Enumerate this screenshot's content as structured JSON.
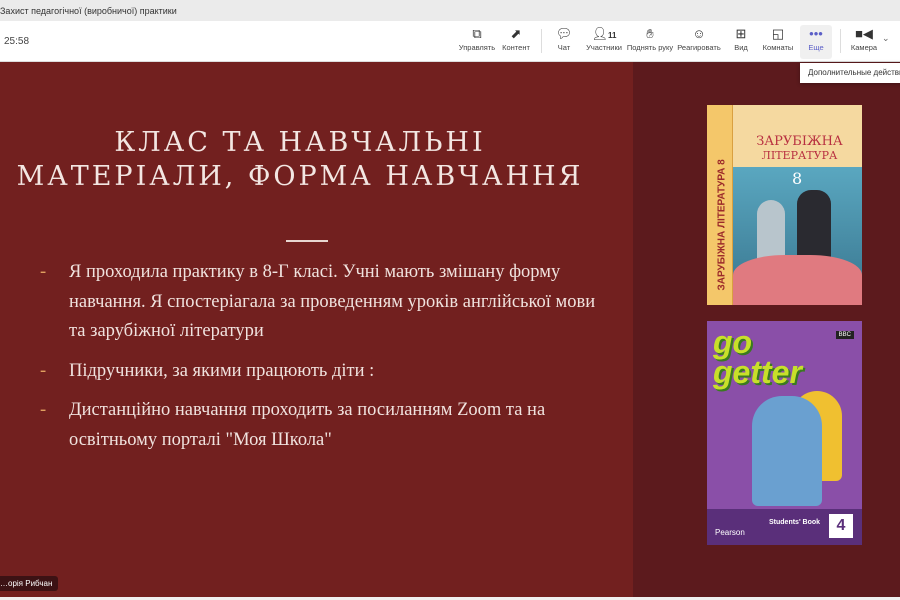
{
  "window": {
    "title": "Захист педагогічної (виробничої) практики"
  },
  "toolbar": {
    "timer": "25:58",
    "buttons": [
      {
        "label": "Управлять",
        "icon": "share-screen-icon"
      },
      {
        "label": "Контент",
        "icon": "content-icon"
      },
      {
        "label": "Чат",
        "icon": "chat-icon"
      },
      {
        "label": "Участники",
        "icon": "participants-icon",
        "count": "11"
      },
      {
        "label": "Поднять руку",
        "icon": "raise-hand-icon"
      },
      {
        "label": "Реагировать",
        "icon": "smile-icon"
      },
      {
        "label": "Вид",
        "icon": "grid-icon"
      },
      {
        "label": "Комнаты",
        "icon": "rooms-icon"
      },
      {
        "label": "Еще",
        "icon": "more-icon"
      },
      {
        "label": "Камера",
        "icon": "camera-icon"
      }
    ],
    "tooltip": "Дополнительные действия"
  },
  "slide": {
    "title_line1": "КЛАС ТА НАВЧАЛЬНІ",
    "title_line2": "МАТЕРІАЛИ, ФОРМА НАВЧАННЯ",
    "bullet_marker": "-",
    "bullets": [
      "Я проходила практику в 8-Г класі. Учні мають змішану форму навчання. Я спостеріагала за проведенням уроків англійської мови та зарубіжної літератури",
      "Підручники, за якими працюють діти :",
      "Дистанційно навчання проходить за посиланням Zoom та на освітньому порталі \"Моя Школа\""
    ],
    "book1": {
      "title1": "ЗАРУБІЖНА",
      "title2": "ЛІТЕРАТУРА",
      "grade": "8",
      "spine": "ЗАРУБІЖНА ЛІТЕРАТУРА 8"
    },
    "book2": {
      "title1": "go",
      "title2": "getter",
      "badge": "BBC",
      "publisher": "Pearson",
      "subtitle": "Students' Book",
      "level": "4"
    }
  },
  "participant": {
    "name": "…орія Рибчан"
  },
  "colors": {
    "slide_bg": "#72201f",
    "panel_bg": "#5c1a1d",
    "accent": "#5b5fc7"
  }
}
